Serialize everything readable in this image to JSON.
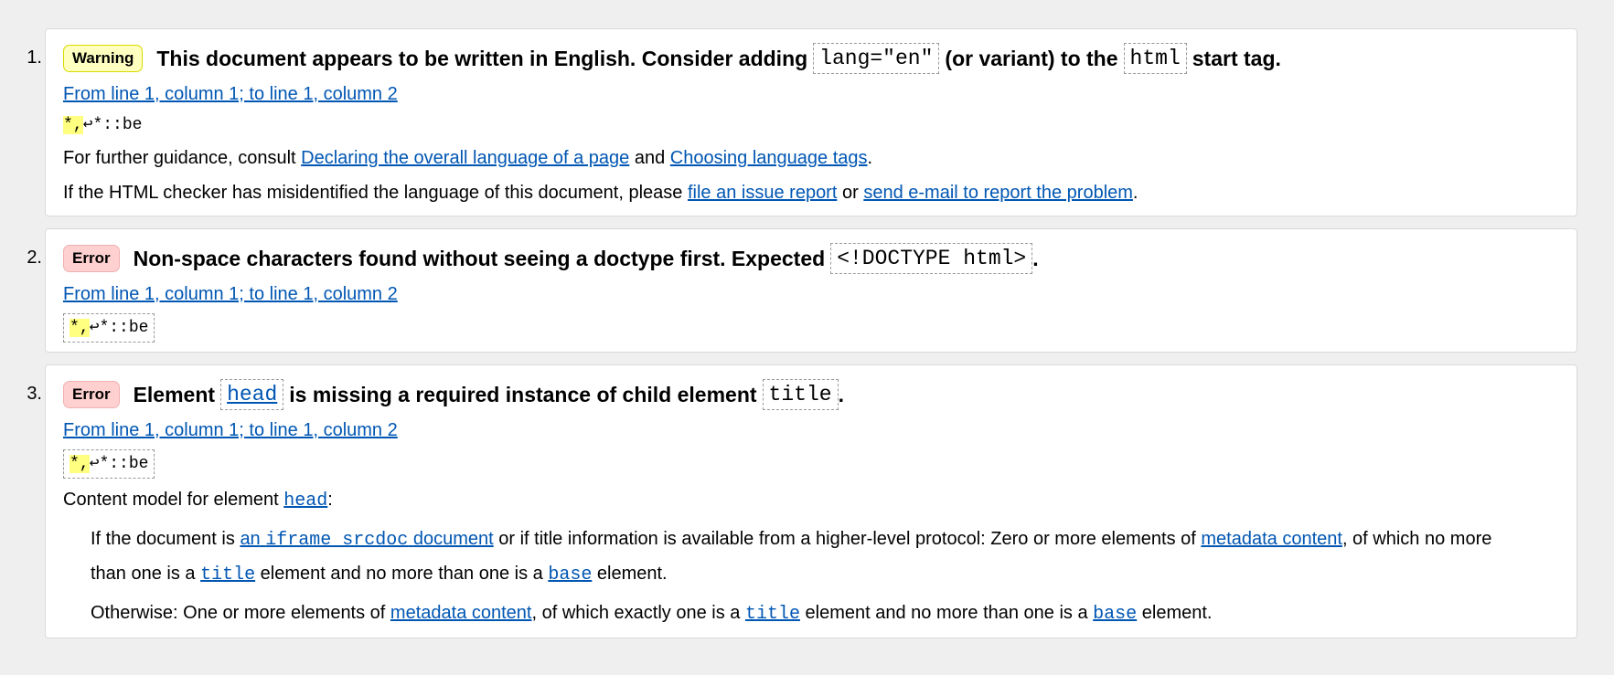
{
  "messages": [
    {
      "num": "1.",
      "type": "Warning",
      "title_pre": "This document appears to be written in English. Consider adding",
      "title_code1": "lang=\"en\"",
      "title_mid": "(or variant) to the",
      "title_code2": "html",
      "title_post": "start tag.",
      "location": "From line 1, column 1; to line 1, column 2",
      "extract_hl": "*,",
      "extract_arrow": "↩",
      "extract_rest": "*::be",
      "p1_pre": "For further guidance, consult",
      "p1_link1": "Declaring the overall language of a page",
      "p1_mid": "and",
      "p1_link2": "Choosing language tags",
      "p1_post": ".",
      "p2_pre": "If the HTML checker has misidentified the language of this document, please",
      "p2_link1": "file an issue report",
      "p2_mid": "or",
      "p2_link2": "send e-mail to report the problem",
      "p2_post": "."
    },
    {
      "num": "2.",
      "type": "Error",
      "title_pre": "Non-space characters found without seeing a doctype first. Expected",
      "title_code": "<!DOCTYPE html>",
      "title_post": ".",
      "location": "From line 1, column 1; to line 1, column 2",
      "extract_hl": "*,",
      "extract_arrow": "↩",
      "extract_rest": "*::be"
    },
    {
      "num": "3.",
      "type": "Error",
      "title_pre": "Element",
      "title_code1": "head",
      "title_mid": "is missing a required instance of child element",
      "title_code2": "title",
      "title_post": ".",
      "location": "From line 1, column 1; to line 1, column 2",
      "extract_hl": "*,",
      "extract_arrow": "↩",
      "extract_rest": "*::be",
      "cm_pre": "Content model for element",
      "cm_code": "head",
      "cm_post": ":",
      "if_pre": "If the document is",
      "if_link_a": "an",
      "if_link_code": "iframe srcdoc",
      "if_link_b": "document",
      "if_mid": "or if title information is available from a higher-level protocol: Zero or more elements of",
      "if_link_meta": "metadata content",
      "if_mid2": ", of which no more",
      "if_line2_pre": "than one is a",
      "if_code_title": "title",
      "if_line2_mid": "element and no more than one is a",
      "if_code_base": "base",
      "if_line2_post": "element.",
      "oth_pre": "Otherwise: One or more elements of",
      "oth_link": "metadata content",
      "oth_mid": ", of which exactly one is a",
      "oth_code_title": "title",
      "oth_mid2": "element and no more than one is a",
      "oth_code_base": "base",
      "oth_post": "element."
    }
  ]
}
